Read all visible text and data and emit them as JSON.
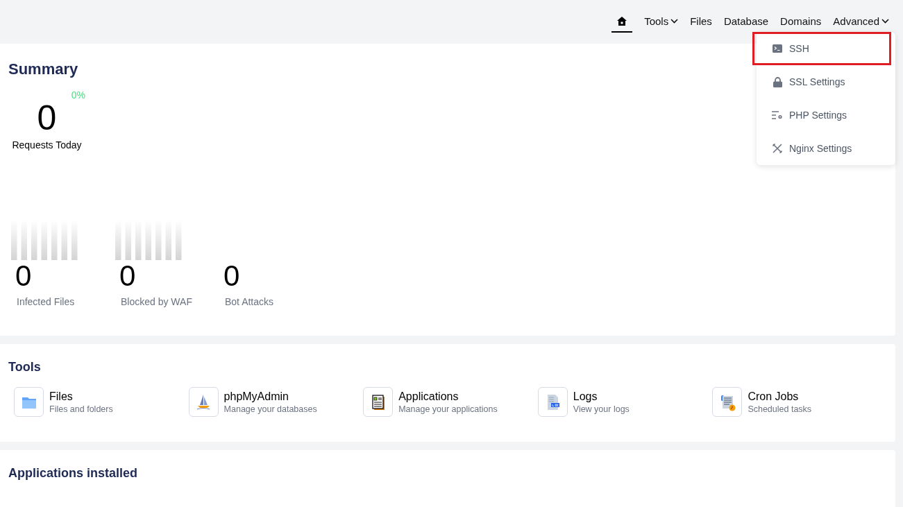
{
  "nav": [
    {
      "kind": "home",
      "selected": true
    },
    {
      "kind": "dropdown",
      "label": "Tools",
      "selected": false
    },
    {
      "kind": "link",
      "label": "Files",
      "selected": false
    },
    {
      "kind": "link",
      "label": "Database",
      "selected": false
    },
    {
      "kind": "link",
      "label": "Domains",
      "selected": false
    },
    {
      "kind": "dropdown",
      "label": "Advanced",
      "selected": false
    }
  ],
  "advanced_menu": [
    {
      "label": "SSH",
      "highlighted": true
    },
    {
      "label": "SSL Settings",
      "highlighted": false
    },
    {
      "label": "PHP Settings",
      "highlighted": false
    },
    {
      "label": "Nginx Settings",
      "highlighted": false
    }
  ],
  "summary": {
    "title": "Summary",
    "change": "0%",
    "requests": "0",
    "requests_label": "Requests Today",
    "stats": [
      {
        "value": "0",
        "label": "Infected Files",
        "sparkline": true
      },
      {
        "value": "0",
        "label": "Blocked by WAF",
        "sparkline": true
      },
      {
        "value": "0",
        "label": "Bot Attacks",
        "sparkline": false
      }
    ]
  },
  "tools": {
    "title": "Tools",
    "items": [
      {
        "title": "Files",
        "subtitle": "Files and folders"
      },
      {
        "title": "phpMyAdmin",
        "subtitle": "Manage your databases"
      },
      {
        "title": "Applications",
        "subtitle": "Manage your applications"
      },
      {
        "title": "Logs",
        "subtitle": "View your logs"
      },
      {
        "title": "Cron Jobs",
        "subtitle": "Scheduled tasks"
      }
    ]
  },
  "applications": {
    "title": "Applications installed"
  }
}
